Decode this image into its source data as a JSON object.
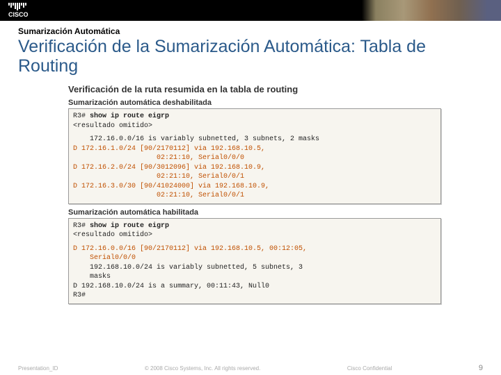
{
  "header": {
    "logo_text": "CISCO"
  },
  "kicker": "Sumarización Automática",
  "title": "Verificación de la Sumarización Automática: Tabla de Routing",
  "section_title": "Verificación de la ruta resumida en la tabla de routing",
  "block1": {
    "label": "Sumarización automática deshabilitada",
    "prompt": "R3#",
    "cmd": "show ip route eigrp",
    "omitted": "<resultado omitido>",
    "line1": "172.16.0.0/16 is variably subnetted, 3 subnets, 2 masks",
    "r1a": "D      172.16.1.0/24 [90/2170112] via 192.168.10.5,",
    "r1b": "02:21:10, Serial0/0/0",
    "r2a": "D      172.16.2.0/24 [90/3012096] via 192.168.10.9,",
    "r2b": "02:21:10, Serial0/0/1",
    "r3a": "D      172.16.3.0/30 [90/41024000] via 192.168.10.9,",
    "r3b": "02:21:10, Serial0/0/1"
  },
  "block2": {
    "label": "Sumarización automática habilitada",
    "prompt": "R3#",
    "cmd": "show ip route eigrp",
    "omitted": "<resultado omitido>",
    "r1a": "D      172.16.0.0/16 [90/2170112] via 192.168.10.5, 00:12:05,",
    "r1b": "Serial0/0/0",
    "r2a": "192.168.10.0/24 is variably subnetted, 5 subnets, 3",
    "r2b": "masks",
    "r3": "D      192.168.10.0/24 is a summary, 00:11:43, Null0",
    "promptend": "R3#"
  },
  "footer": {
    "left": "Presentation_ID",
    "center": "© 2008 Cisco Systems, Inc. All rights reserved.",
    "right": "Cisco Confidential",
    "page": "9"
  }
}
